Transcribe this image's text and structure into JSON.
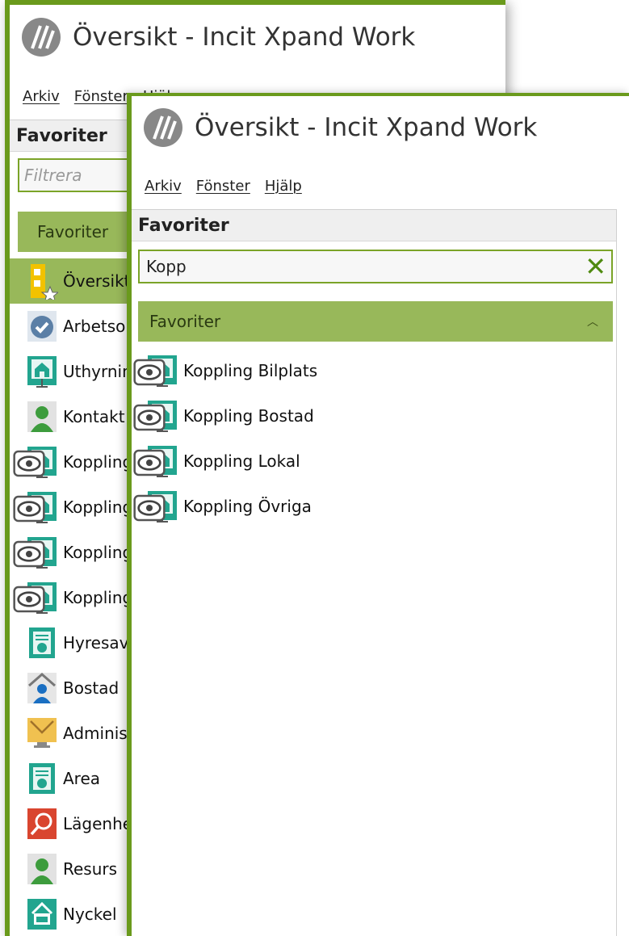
{
  "back_window": {
    "title": "Översikt - Incit Xpand Work",
    "menu": [
      "Arkiv",
      "Fönster",
      "Hjälp"
    ],
    "panel_title": "Favoriter",
    "filter_placeholder": "Filtrera",
    "group_label": "Favoriter",
    "items": [
      {
        "label": "Översikt",
        "icon": "overview-star-icon"
      },
      {
        "label": "Arbetsorder",
        "icon": "work-order-check-icon"
      },
      {
        "label": "Uthyrning",
        "icon": "property-icon"
      },
      {
        "label": "Kontakt",
        "icon": "person-icon"
      },
      {
        "label": "Koppling Bilplats",
        "icon": "link-property-icon"
      },
      {
        "label": "Koppling Bostad",
        "icon": "link-property-icon"
      },
      {
        "label": "Koppling Lokal",
        "icon": "link-property-icon"
      },
      {
        "label": "Koppling Övriga",
        "icon": "link-property-icon"
      },
      {
        "label": "Hyresavtal",
        "icon": "contract-icon"
      },
      {
        "label": "Bostad",
        "icon": "house-person-icon"
      },
      {
        "label": "Administration",
        "icon": "mail-monitor-icon"
      },
      {
        "label": "Area",
        "icon": "contract-icon"
      },
      {
        "label": "Lägenhet",
        "icon": "search-red-icon"
      },
      {
        "label": "Resurs",
        "icon": "person-icon"
      },
      {
        "label": "Nyckel",
        "icon": "key-box-icon"
      }
    ]
  },
  "front_window": {
    "title": "Översikt - Incit Xpand Work",
    "menu": [
      "Arkiv",
      "Fönster",
      "Hjälp"
    ],
    "panel_title": "Favoriter",
    "filter_value": "Kopp",
    "group_label": "Favoriter",
    "items": [
      {
        "label": "Koppling Bilplats",
        "icon": "link-property-icon"
      },
      {
        "label": "Koppling Bostad",
        "icon": "link-property-icon"
      },
      {
        "label": "Koppling Lokal",
        "icon": "link-property-icon"
      },
      {
        "label": "Koppling Övriga",
        "icon": "link-property-icon"
      }
    ]
  },
  "colors": {
    "accent_border": "#6a9a1c",
    "group_header": "#98b85a",
    "clear_x": "#4f8a10",
    "teal_icon": "#22a58f",
    "selected_item": "#98b85a"
  }
}
